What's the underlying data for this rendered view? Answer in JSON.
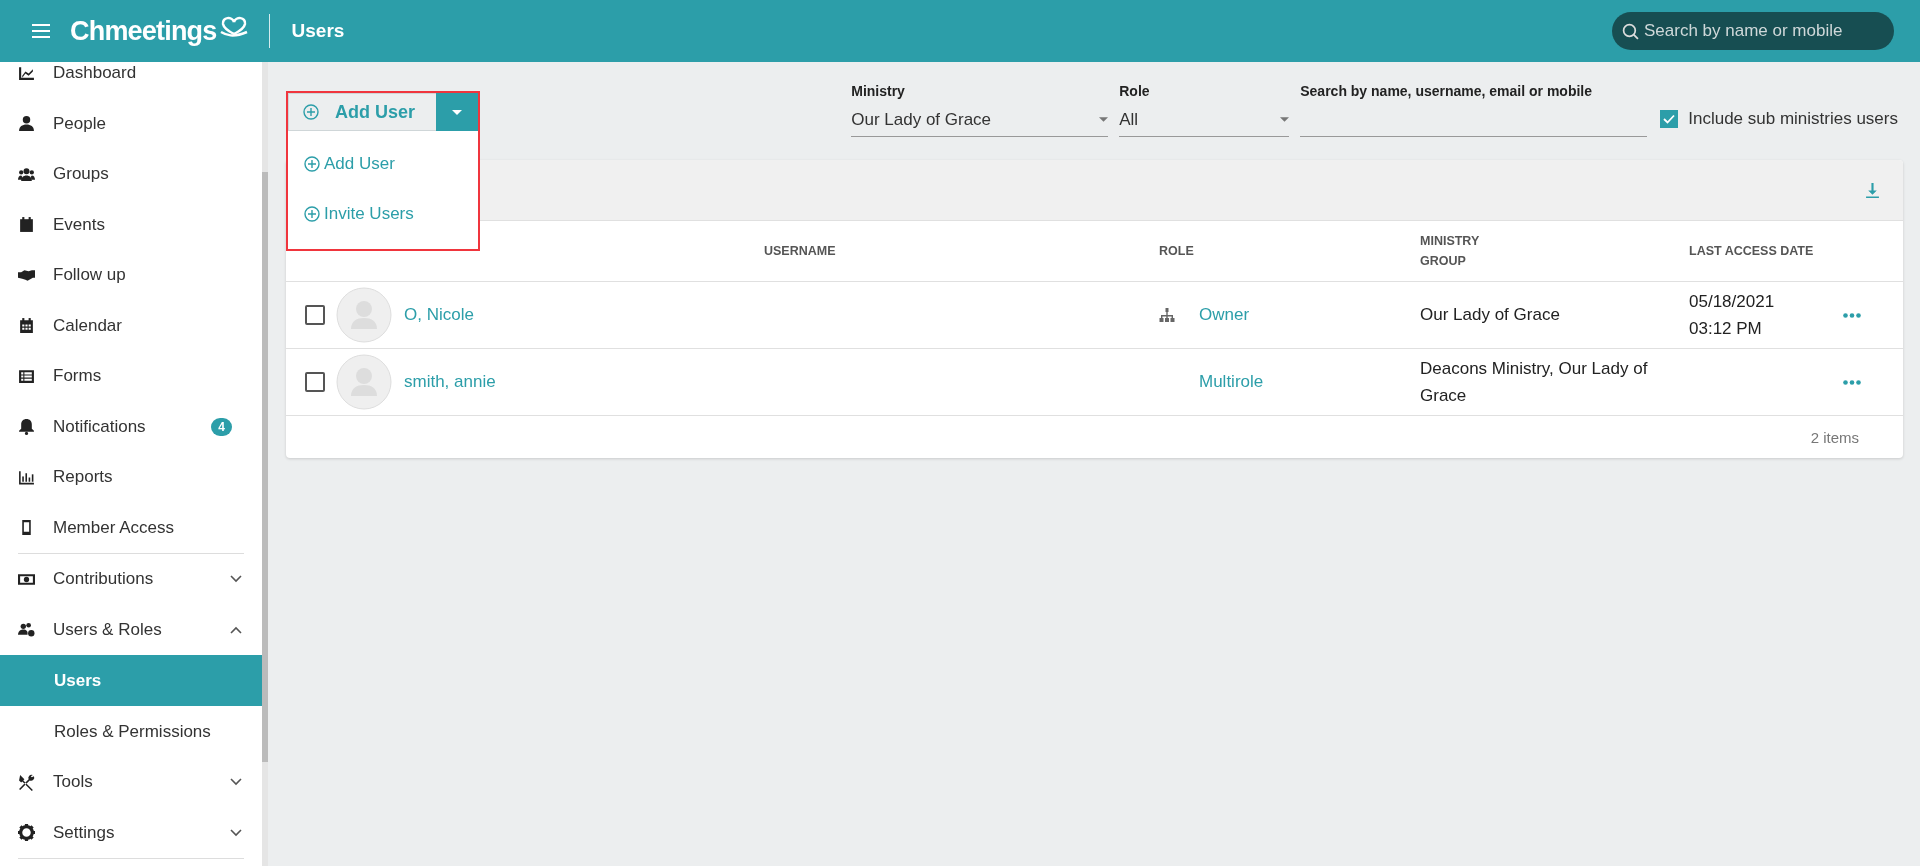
{
  "header": {
    "brand": "Chmeetings",
    "title": "Users",
    "search": {
      "placeholder": "Search by name or mobile"
    }
  },
  "sidebar": {
    "items": [
      {
        "kind": "item",
        "label": "Dashboard"
      },
      {
        "kind": "item",
        "label": "People"
      },
      {
        "kind": "item",
        "label": "Groups"
      },
      {
        "kind": "item",
        "label": "Events"
      },
      {
        "kind": "item",
        "label": "Follow up"
      },
      {
        "kind": "item",
        "label": "Calendar"
      },
      {
        "kind": "item",
        "label": "Forms"
      },
      {
        "kind": "item",
        "label": "Notifications",
        "badge": "4"
      },
      {
        "kind": "item",
        "label": "Reports"
      },
      {
        "kind": "item",
        "label": "Member Access"
      },
      {
        "kind": "divider"
      },
      {
        "kind": "group",
        "label": "Contributions",
        "expanded": false
      },
      {
        "kind": "group",
        "label": "Users & Roles",
        "expanded": true
      },
      {
        "kind": "sub",
        "label": "Users",
        "selected": true
      },
      {
        "kind": "sub",
        "label": "Roles & Permissions",
        "selected": false
      },
      {
        "kind": "group",
        "label": "Tools",
        "expanded": false
      },
      {
        "kind": "group",
        "label": "Settings",
        "expanded": false
      },
      {
        "kind": "divider"
      }
    ]
  },
  "add_button": {
    "label": "Add User"
  },
  "add_menu": {
    "items": [
      "Add User",
      "Invite Users"
    ]
  },
  "filters": {
    "ministry": {
      "label": "Ministry",
      "value": "Our Lady of Grace"
    },
    "role": {
      "label": "Role",
      "value": "All"
    },
    "search": {
      "label": "Search by name, username, email or mobile"
    },
    "include_sub": {
      "label": "Include sub ministries users",
      "checked": true
    }
  },
  "table": {
    "columns": [
      {
        "lines": [
          "USERNAME"
        ]
      },
      {
        "lines": [
          "ROLE"
        ]
      },
      {
        "lines": [
          "MINISTRY",
          "GROUP"
        ]
      },
      {
        "lines": [
          "LAST ACCESS DATE"
        ]
      }
    ],
    "rows": [
      {
        "checked": false,
        "name": "O, Nicole",
        "role": "Owner",
        "role_icon": true,
        "ministry": "Our Lady of Grace",
        "last_access": [
          "05/18/2021",
          "03:12 PM"
        ]
      },
      {
        "checked": false,
        "name": "smith, annie",
        "role": "Multirole",
        "role_icon": false,
        "ministry": "Deacons Ministry, Our Lady of Grace",
        "last_access": []
      }
    ],
    "footer": "2 items"
  }
}
